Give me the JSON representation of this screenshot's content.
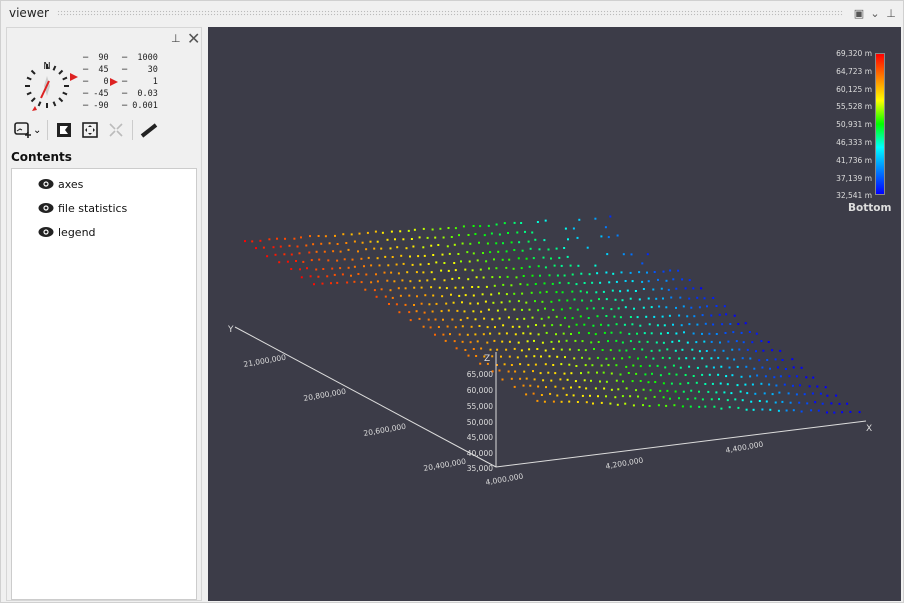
{
  "window": {
    "title": "viewer",
    "icons": [
      "restore-icon",
      "chevron-down-icon",
      "pin-icon"
    ]
  },
  "panel": {
    "icons": [
      "pin-icon",
      "close-icon"
    ],
    "pitch_scale": [
      "90",
      "45",
      "0",
      "-45",
      "-90"
    ],
    "zoom_scale": [
      "1000",
      "30",
      "1",
      "0.03",
      "0.001"
    ],
    "toolbar": [
      "add-layer-icon",
      "chevron-down-icon",
      "full-extent-icon",
      "zoom-to-fit-icon",
      "collapse-icon",
      "measure-ruler-icon"
    ],
    "contents_title": "Contents",
    "layers": [
      {
        "label": "axes",
        "visible": true
      },
      {
        "label": "file statistics",
        "visible": true
      },
      {
        "label": "legend",
        "visible": true
      }
    ]
  },
  "viewer": {
    "background": "#3c3c48",
    "axes": {
      "x_label": "X",
      "y_label": "Y",
      "z_label": "Z",
      "x_ticks": [
        "4,000,000",
        "4,200,000",
        "4,400,000"
      ],
      "y_ticks": [
        "21,000,000",
        "20,800,000",
        "20,600,000",
        "20,400,000"
      ],
      "z_ticks": [
        "65,000",
        "60,000",
        "55,000",
        "50,000",
        "45,000",
        "40,000",
        "35,000"
      ]
    },
    "legend": {
      "labels": [
        "69,320 m",
        "64,723 m",
        "60,125 m",
        "55,528 m",
        "50,931 m",
        "46,333 m",
        "41,736 m",
        "37,139 m",
        "32,541 m"
      ],
      "title": "Bottom",
      "colors": [
        "#ff0000",
        "#ff8000",
        "#ffff00",
        "#00ff00",
        "#00ffff",
        "#0000ff"
      ]
    }
  }
}
